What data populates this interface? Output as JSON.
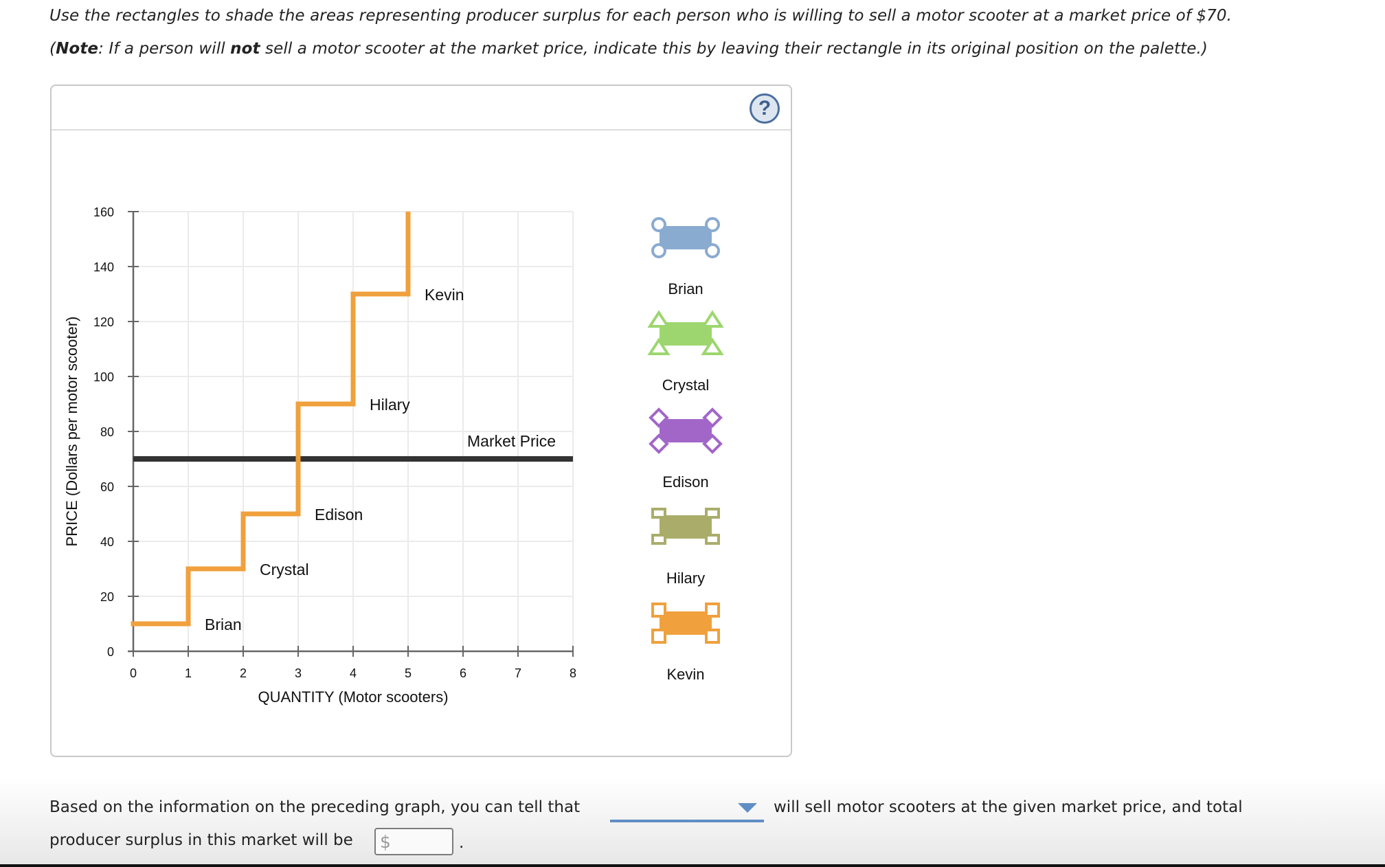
{
  "instructions": {
    "line1": "Use the rectangles to shade the areas representing producer surplus for each person who is willing to sell a motor scooter at a market price of $70.",
    "line2_prefix": "(",
    "line2_note": "Note",
    "line2_mid": ": If a person will ",
    "line2_not": "not",
    "line2_suffix": " sell a motor scooter at the market price, indicate this by leaving their rectangle in its original position on the palette.)"
  },
  "help_button": {
    "label": "?"
  },
  "chart_data": {
    "type": "line",
    "subtype": "step-supply-curve",
    "xlabel": "QUANTITY (Motor scooters)",
    "ylabel": "PRICE (Dollars per motor scooter)",
    "xlim": [
      0,
      8
    ],
    "ylim": [
      0,
      160
    ],
    "x_ticks": [
      0,
      1,
      2,
      3,
      4,
      5,
      6,
      7,
      8
    ],
    "y_ticks": [
      0,
      20,
      40,
      60,
      80,
      100,
      120,
      140,
      160
    ],
    "grid": true,
    "supply_steps": [
      {
        "seller": "Brian",
        "x_start": 0,
        "x_end": 1,
        "price": 10
      },
      {
        "seller": "Crystal",
        "x_start": 1,
        "x_end": 2,
        "price": 30
      },
      {
        "seller": "Edison",
        "x_start": 2,
        "x_end": 3,
        "price": 50
      },
      {
        "seller": "Hilary",
        "x_start": 3,
        "x_end": 4,
        "price": 90
      },
      {
        "seller": "Kevin",
        "x_start": 4,
        "x_end": 5,
        "price": 130
      }
    ],
    "supply_top": 160,
    "market_price": {
      "label": "Market Price",
      "value": 70
    },
    "colors": {
      "supply": "#f0a03c",
      "market_price": "#333333"
    }
  },
  "palette": {
    "items": [
      {
        "label": "Brian",
        "color": "#8aabd0",
        "handle": "circle"
      },
      {
        "label": "Crystal",
        "color": "#9dd66f",
        "handle": "triangle"
      },
      {
        "label": "Edison",
        "color": "#a266c9",
        "handle": "diamond"
      },
      {
        "label": "Hilary",
        "color": "#aaad6a",
        "handle": "square-small"
      },
      {
        "label": "Kevin",
        "color": "#f0a03c",
        "handle": "square"
      }
    ]
  },
  "question": {
    "line1_prefix": "Based on the information on the preceding graph, you can tell that",
    "line1_suffix": "will sell motor scooters at the given market price, and total",
    "line2_prefix": "producer surplus in this market will be",
    "dropdown_value": "",
    "input_currency": "$",
    "input_value": "",
    "period": "."
  }
}
